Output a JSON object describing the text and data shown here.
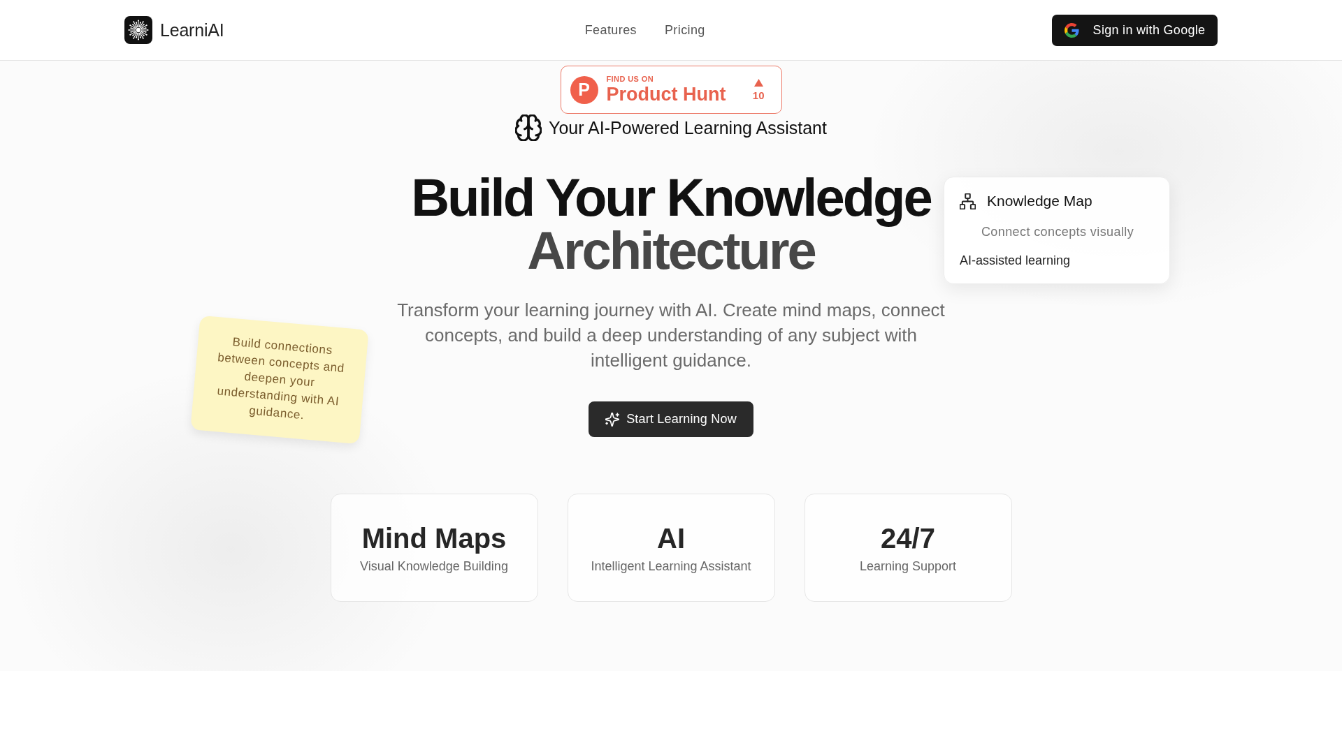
{
  "header": {
    "brand": "LearniAI",
    "nav": [
      {
        "label": "Features"
      },
      {
        "label": "Pricing"
      }
    ],
    "sign_in_button": "Sign in with Google"
  },
  "hero": {
    "badge": {
      "logo_letter": "P",
      "overline": "FIND US ON",
      "name": "Product Hunt",
      "votes": "10"
    },
    "tagline": "Your AI-Powered Learning Assistant",
    "title_lines": [
      "Build Your Knowledge",
      "Architecture"
    ],
    "subtitle": "Transform your learning journey with AI. Create mind maps, connect concepts, and build a deep understanding of any subject with intelligent guidance.",
    "cta_button": "Start Learning Now",
    "stats": [
      {
        "value": "Mind Maps",
        "label": "Visual Knowledge Building"
      },
      {
        "value": "AI",
        "label": "Intelligent Learning Assistant"
      },
      {
        "value": "24/7",
        "label": "Learning Support"
      }
    ]
  },
  "floating_card": {
    "title": "Knowledge Map",
    "subtitle": "Connect concepts visually",
    "text": "AI-assisted learning"
  },
  "sticky_note": {
    "text": "Build connections between concepts and deepen your understanding with AI guidance."
  }
}
